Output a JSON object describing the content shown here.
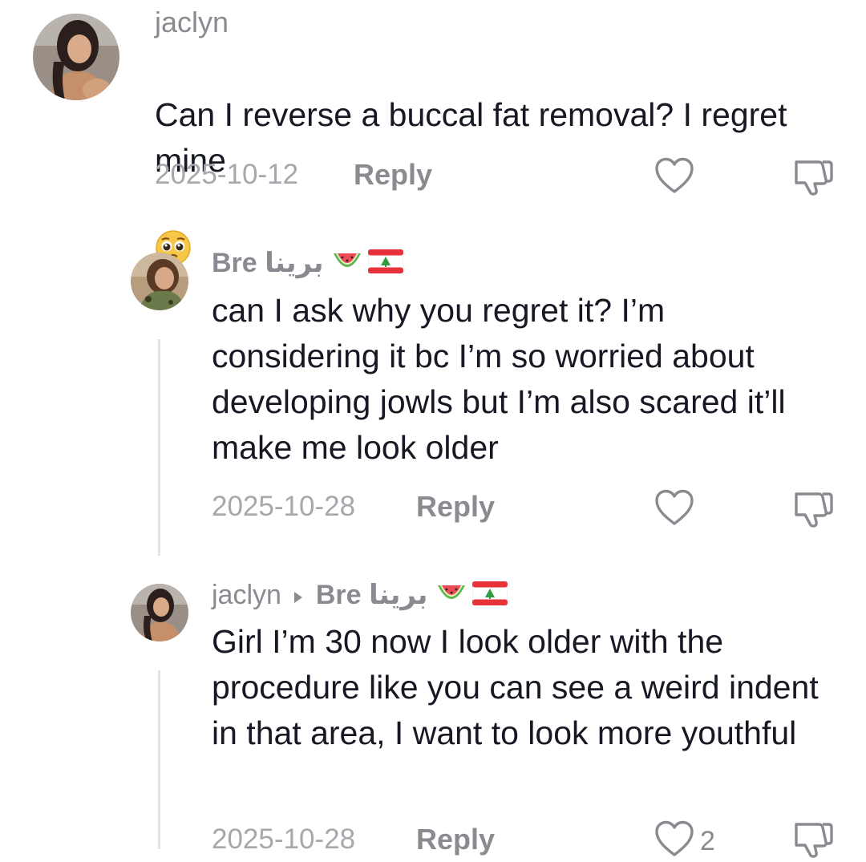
{
  "comments": [
    {
      "username": "jaclyn",
      "text": "Can I reverse a buccal fat removal? I regret mine",
      "emoji": "pleading-face",
      "date": "2025-10-12",
      "reply_label": "Reply",
      "like_count": ""
    },
    {
      "username": "Bre",
      "username_arabic": "برينا",
      "username_emojis": [
        "watermelon",
        "lebanon-flag"
      ],
      "text": "can I ask why you regret it? I’m considering it bc I’m so worried about developing jowls but I’m also scared it’ll make me look older",
      "date": "2025-10-28",
      "reply_label": "Reply",
      "like_count": ""
    },
    {
      "username": "jaclyn",
      "reply_to": "Bre",
      "reply_to_arabic": "برينا",
      "reply_to_emojis": [
        "watermelon",
        "lebanon-flag"
      ],
      "text": "Girl I’m 30 now I look older with the procedure like you can see a weird indent in that area, I want to look more youthful",
      "date": "2025-10-28",
      "reply_label": "Reply",
      "like_count": "2"
    }
  ],
  "icons": {
    "like": "heart-outline-icon",
    "dislike": "thumbs-down-icon",
    "reply_arrow": "triangle-right-icon"
  },
  "colors": {
    "username": "#8a8b91",
    "text": "#161823",
    "date": "#a7a8ad",
    "thread_line": "#e3e3e4"
  }
}
